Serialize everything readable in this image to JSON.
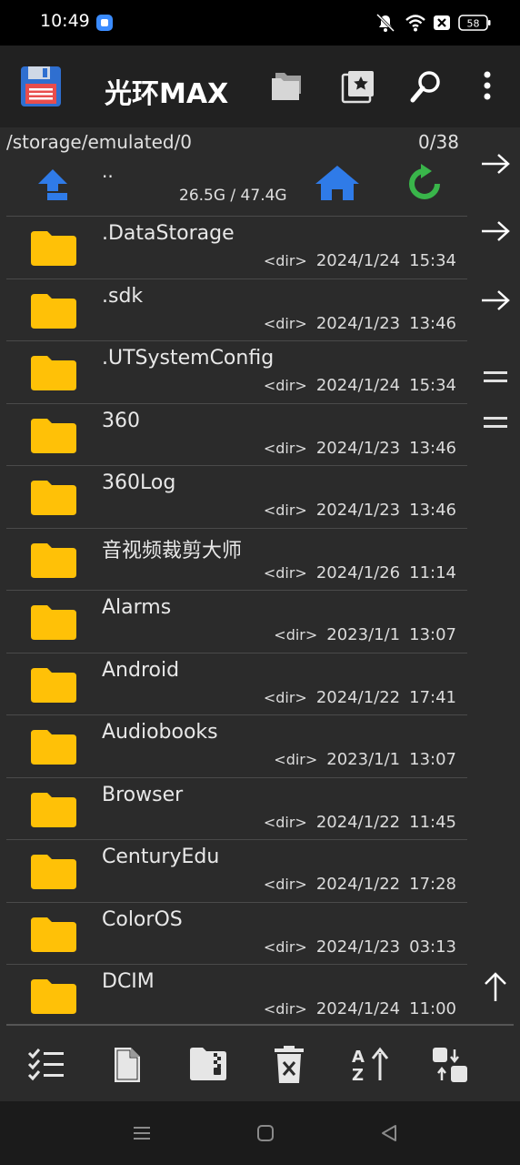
{
  "status_bar": {
    "time": "10:49",
    "battery": "58"
  },
  "app_bar": {
    "title": "光环MAX",
    "icons": [
      "save-disk-icon",
      "folders-icon",
      "bookmarks-star-icon",
      "search-icon",
      "more-vert-icon"
    ]
  },
  "path": {
    "current": "/storage/emulated/0",
    "count": "0/38"
  },
  "nav_row": {
    "parent_label": "..",
    "storage": "26.5G / 47.4G"
  },
  "files": [
    {
      "name": ".DataStorage",
      "tag": "<dir>",
      "date": "2024/1/24",
      "time": "15:34"
    },
    {
      "name": ".sdk",
      "tag": "<dir>",
      "date": "2024/1/23",
      "time": "13:46"
    },
    {
      "name": ".UTSystemConfig",
      "tag": "<dir>",
      "date": "2024/1/24",
      "time": "15:34"
    },
    {
      "name": "360",
      "tag": "<dir>",
      "date": "2024/1/23",
      "time": "13:46"
    },
    {
      "name": "360Log",
      "tag": "<dir>",
      "date": "2024/1/23",
      "time": "13:46"
    },
    {
      "name": "音视频裁剪大师",
      "tag": "<dir>",
      "date": "2024/1/26",
      "time": "11:14"
    },
    {
      "name": "Alarms",
      "tag": "<dir>",
      "date": "2023/1/1",
      "time": "13:07"
    },
    {
      "name": "Android",
      "tag": "<dir>",
      "date": "2024/1/22",
      "time": "17:41"
    },
    {
      "name": "Audiobooks",
      "tag": "<dir>",
      "date": "2023/1/1",
      "time": "13:07"
    },
    {
      "name": "Browser",
      "tag": "<dir>",
      "date": "2024/1/22",
      "time": "11:45"
    },
    {
      "name": "CenturyEdu",
      "tag": "<dir>",
      "date": "2024/1/22",
      "time": "17:28"
    },
    {
      "name": "ColorOS",
      "tag": "<dir>",
      "date": "2024/1/23",
      "time": "03:13"
    },
    {
      "name": "DCIM",
      "tag": "<dir>",
      "date": "2024/1/24",
      "time": "11:00"
    }
  ],
  "colors": {
    "folder": "#ffc107",
    "accent_blue": "#2f7be8",
    "refresh_green": "#39b54a"
  }
}
